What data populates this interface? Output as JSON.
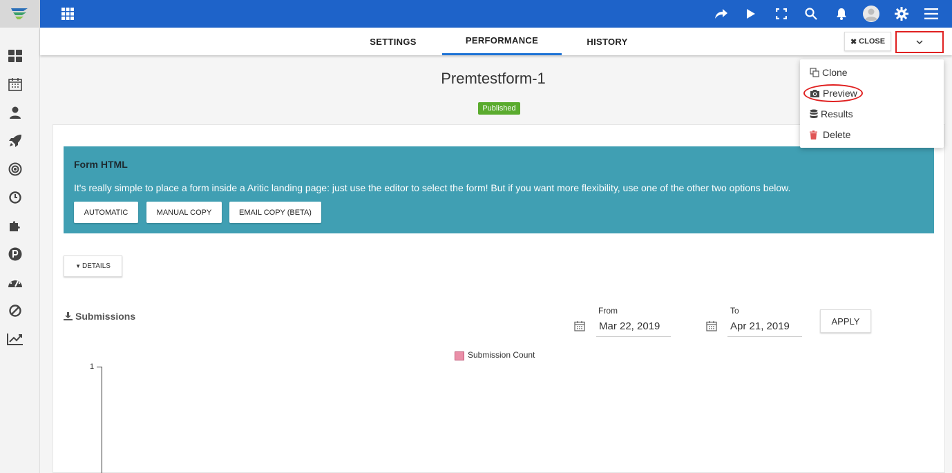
{
  "app": {
    "logo": "brand-logo"
  },
  "topbar": {
    "icons": [
      "share-icon",
      "play-icon",
      "fullscreen-icon",
      "search-icon",
      "bell-icon",
      "user-avatar-icon",
      "gear-icon",
      "menu-icon"
    ]
  },
  "sidebar": {
    "items": [
      "dashboard-icon",
      "calendar-icon",
      "contacts-icon",
      "rocket-icon",
      "target-icon",
      "clock-icon",
      "puzzle-icon",
      "points-icon",
      "speedometer-icon",
      "block-icon",
      "chart-icon"
    ]
  },
  "tabs": [
    {
      "label": "SETTINGS",
      "active": false
    },
    {
      "label": "PERFORMANCE",
      "active": true
    },
    {
      "label": "HISTORY",
      "active": false
    }
  ],
  "toolbar": {
    "close_label": "CLOSE"
  },
  "page": {
    "title": "Premtestform-1",
    "status": "Published"
  },
  "form_html": {
    "title": "Form HTML",
    "text": "It's really simple to place a form inside a Aritic landing page: just use the editor to select the form! But if you want more flexibility, use one of the other two options below.",
    "buttons": [
      "AUTOMATIC",
      "MANUAL COPY",
      "EMAIL COPY (BETA)"
    ]
  },
  "details": {
    "label": "DETAILS"
  },
  "submissions": {
    "title": "Submissions",
    "from_label": "From",
    "from_value": "Mar 22, 2019",
    "to_label": "To",
    "to_value": "Apr 21, 2019",
    "apply_label": "APPLY"
  },
  "menu": {
    "items": [
      {
        "label": "Clone",
        "icon": "clone-icon"
      },
      {
        "label": "Preview",
        "icon": "camera-icon"
      },
      {
        "label": "Results",
        "icon": "database-icon"
      },
      {
        "label": "Delete",
        "icon": "trash-icon"
      }
    ]
  },
  "colors": {
    "topbar": "#1e63c9",
    "accent_tab": "#1e73d6",
    "form_html_bg": "#409fb3",
    "published": "#5aab2e",
    "highlight": "#e02020",
    "series": "#ea8fa8"
  },
  "chart_data": {
    "type": "bar",
    "series": [
      {
        "name": "Submission Count",
        "values": []
      }
    ],
    "yticks": [
      "1"
    ]
  }
}
